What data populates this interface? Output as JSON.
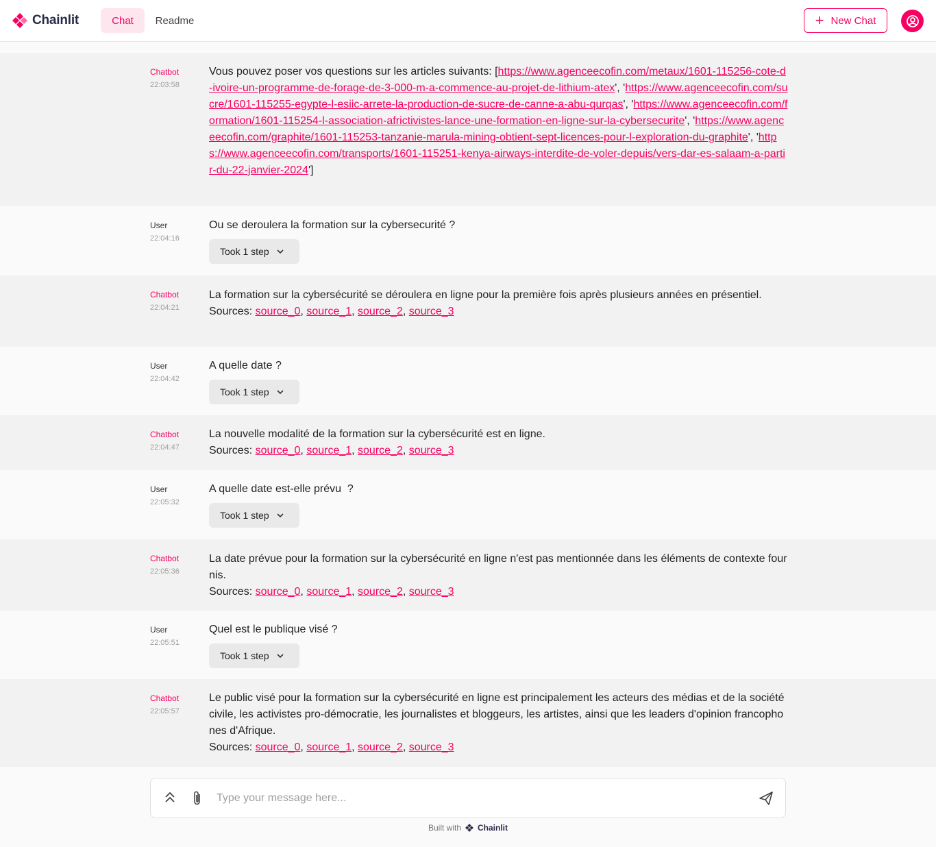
{
  "header": {
    "logo_text": "Chainlit",
    "tabs": [
      {
        "label": "Chat",
        "active": true
      },
      {
        "label": "Readme",
        "active": false
      }
    ],
    "new_chat_label": "New Chat"
  },
  "colors": {
    "accent": "#F80061",
    "bot_row_bg": "#f2f2f2",
    "user_row_bg": "#fafafa"
  },
  "messages": [
    {
      "author": "Chatbot",
      "time": "22:03:58",
      "intro": "Vous pouvez poser vos questions sur les articles suivants: [",
      "links": [
        "https://www.agenceecofin.com/metaux/1601-115256-cote-d-ivoire-un-programme-de-forage-de-3-000-m-a-commence-au-projet-de-lithium-atex",
        "https://www.agenceecofin.com/sucre/1601-115255-egypte-l-esiic-arrete-la-production-de-sucre-de-canne-a-abu-qurqas",
        "https://www.agenceecofin.com/formation/1601-115254-l-association-africtivistes-lance-une-formation-en-ligne-sur-la-cybersecurite",
        "https://www.agenceecofin.com/graphite/1601-115253-tanzanie-marula-mining-obtient-sept-licences-pour-l-exploration-du-graphite",
        "https://www.agenceecofin.com/transports/1601-115251-kenya-airways-interdite-de-voler-depuis/vers-dar-es-salaam-a-partir-du-22-janvier-2024"
      ],
      "outro": "]"
    },
    {
      "author": "User",
      "time": "22:04:16",
      "text": "Ou se deroulera la formation sur la cybersecurité ?",
      "step_label": "Took 1 step"
    },
    {
      "author": "Chatbot",
      "time": "22:04:21",
      "text": "La formation sur la cybersécurité se déroulera en ligne pour la première fois après plusieurs années en présentiel.",
      "sources_label": "Sources:",
      "sources": [
        "source_0",
        "source_1",
        "source_2",
        "source_3"
      ]
    },
    {
      "author": "User",
      "time": "22:04:42",
      "text": "A quelle date ?",
      "step_label": "Took 1 step"
    },
    {
      "author": "Chatbot",
      "time": "22:04:47",
      "text": "La nouvelle modalité de la formation sur la cybersécurité est en ligne.",
      "sources_label": "Sources:",
      "sources": [
        "source_0",
        "source_1",
        "source_2",
        "source_3"
      ]
    },
    {
      "author": "User",
      "time": "22:05:32",
      "text": "A quelle date est-elle prévu  ?",
      "step_label": "Took 1 step"
    },
    {
      "author": "Chatbot",
      "time": "22:05:36",
      "text": "La date prévue pour la formation sur la cybersécurité en ligne n'est pas mentionnée dans les éléments de contexte fournis.",
      "sources_label": "Sources:",
      "sources": [
        "source_0",
        "source_1",
        "source_2",
        "source_3"
      ]
    },
    {
      "author": "User",
      "time": "22:05:51",
      "text": "Quel est le publique visé ?",
      "step_label": "Took 1 step"
    },
    {
      "author": "Chatbot",
      "time": "22:05:57",
      "text": "Le public visé pour la formation sur la cybersécurité en ligne est principalement les acteurs des médias et de la société civile, les activistes pro-démocratie, les journalistes et bloggeurs, les artistes, ainsi que les leaders d'opinion francophones d'Afrique.",
      "sources_label": "Sources:",
      "sources": [
        "source_0",
        "source_1",
        "source_2",
        "source_3"
      ]
    }
  ],
  "composer": {
    "placeholder": "Type your message here..."
  },
  "footer": {
    "built_with": "Built with",
    "brand": "Chainlit"
  },
  "icons": {
    "logo": "chainlit-logo-icon",
    "plus": "plus-icon",
    "avatar": "user-avatar-icon",
    "chevron": "chevron-down-icon",
    "settings": "double-chevron-up-icon",
    "attach": "paperclip-icon",
    "send": "send-icon"
  }
}
